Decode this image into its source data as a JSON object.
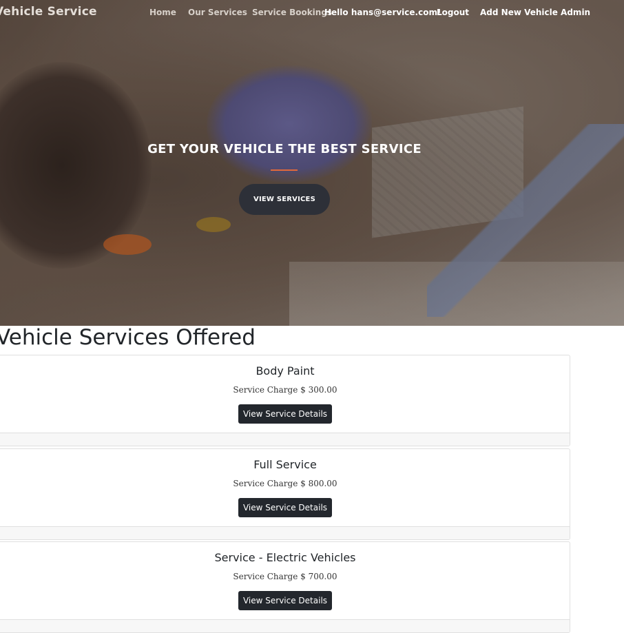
{
  "navbar": {
    "brand": "Vehicle Service",
    "links": [
      "Home",
      "Our Services",
      "Service Bookings"
    ],
    "greeting": "Hello hans@service.com!",
    "logout": "Logout",
    "admin": "Add New Vehicle Admin"
  },
  "hero": {
    "title": "GET YOUR VEHICLE THE BEST SERVICE",
    "button": "VIEW SERVICES",
    "accent_color": "#e2693b"
  },
  "services": {
    "heading": "Vehicle Services Offered",
    "items": [
      {
        "name": "Body Paint",
        "charge": "Service Charge $ 300.00",
        "button": "View Service Details"
      },
      {
        "name": "Full Service",
        "charge": "Service Charge $ 800.00",
        "button": "View Service Details"
      },
      {
        "name": "Service - Electric Vehicles",
        "charge": "Service Charge $ 700.00",
        "button": "View Service Details"
      }
    ]
  }
}
